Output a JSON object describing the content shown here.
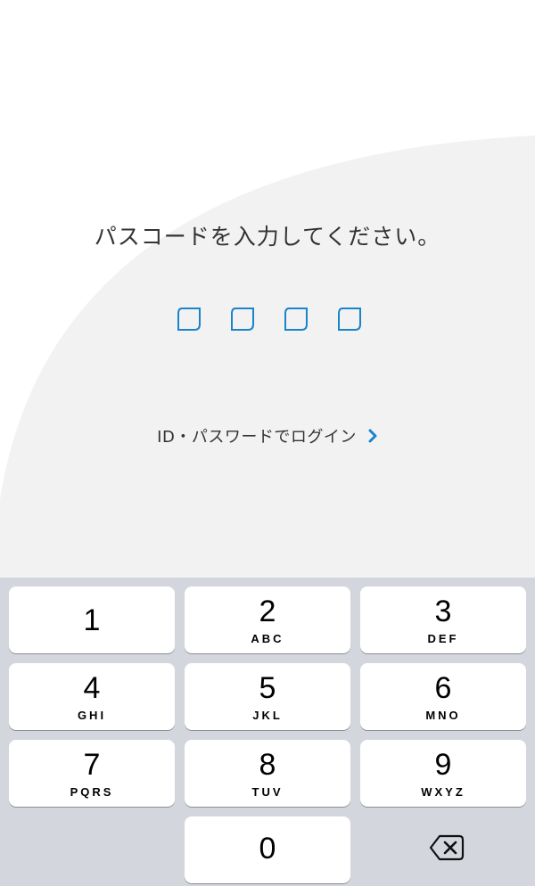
{
  "prompt": "パスコードを入力してください。",
  "passcode_length": 4,
  "login_link": {
    "label": "ID・パスワードでログイン"
  },
  "colors": {
    "accent": "#1a84c9",
    "background_arc": "#f2f2f3",
    "keyboard": "#d3d6dc",
    "key": "#ffffff"
  },
  "keypad": {
    "keys": [
      {
        "digit": "1",
        "letters": ""
      },
      {
        "digit": "2",
        "letters": "ABC"
      },
      {
        "digit": "3",
        "letters": "DEF"
      },
      {
        "digit": "4",
        "letters": "GHI"
      },
      {
        "digit": "5",
        "letters": "JKL"
      },
      {
        "digit": "6",
        "letters": "MNO"
      },
      {
        "digit": "7",
        "letters": "PQRS"
      },
      {
        "digit": "8",
        "letters": "TUV"
      },
      {
        "digit": "9",
        "letters": "WXYZ"
      },
      {
        "digit": "0",
        "letters": ""
      }
    ],
    "delete_icon": "backspace-icon"
  }
}
